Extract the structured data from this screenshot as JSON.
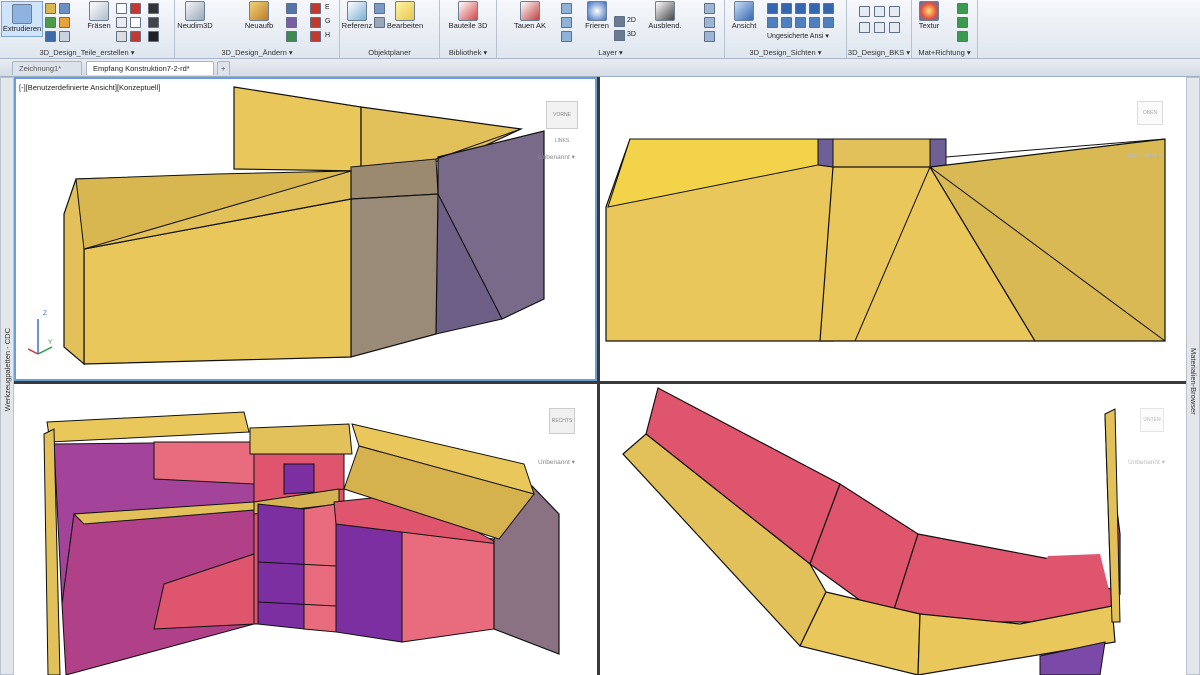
{
  "ribbon": {
    "panels": [
      {
        "id": "teile",
        "title": "3D_Design_Teile_erstellen ▾",
        "buttons": [
          "Extrudieren",
          "Fräsen"
        ]
      },
      {
        "id": "aendern",
        "title": "3D_Design_Ändern ▾",
        "buttons": [
          "Neudim3D",
          "Neuaufb"
        ],
        "small_labels": [
          "E",
          "G",
          "H"
        ]
      },
      {
        "id": "objekt",
        "title": "Objektplaner",
        "buttons": [
          "Referenz",
          "Bearbeiten"
        ]
      },
      {
        "id": "biblio",
        "title": "Bibliothek ▾",
        "buttons": [
          "Bauteile 3D"
        ]
      },
      {
        "id": "layer",
        "title": "Layer ▾",
        "buttons": [
          "Tauen AK",
          "Frieren",
          "Ausblend."
        ],
        "small_labels": [
          "2D",
          "3D"
        ]
      },
      {
        "id": "sichten",
        "title": "3D_Design_Sichten ▾",
        "buttons": [
          "Ansicht"
        ],
        "dropdown": "Ungesicherte Ansi ▾"
      },
      {
        "id": "bks",
        "title": "3D_Design_BKS ▾",
        "buttons": []
      },
      {
        "id": "mat",
        "title": "Mat+Richtung ▾",
        "buttons": [
          "Textur"
        ]
      }
    ]
  },
  "tabs": {
    "items": [
      "Zeichnung1*",
      "Empfang Konstruktion7-2-rd*"
    ],
    "add": "+"
  },
  "sidebars": {
    "left": "Werkzeugpaletten - CDC",
    "right": "Materialien-Browser"
  },
  "viewports": {
    "top_left": {
      "label": "[-][Benutzerdefinierte Ansicht][Konzeptuell]",
      "cube": "VORNE LINKS",
      "ucs": "Unbenannt ▾",
      "axis_z": "Z",
      "axis_y": "Y"
    },
    "top_right": {
      "cube": "OBEN",
      "ucs": "Unbenannt ▾"
    },
    "bottom_left": {
      "cube": "RECHTS",
      "ucs": "Unbenannt ▾"
    },
    "bottom_right": {
      "cube": "UNTEN",
      "ucs": "Unbenannt ▾"
    }
  },
  "colors": {
    "yellow": "#e9c75a",
    "yellow_dark": "#d6b24e",
    "purple": "#7a6a8a",
    "purple_dark": "#6e5f86",
    "pink": "#e0556e",
    "pink_light": "#e96c7e",
    "violet": "#7b2fa1",
    "ribbon_bg": "#dfe6ef"
  }
}
